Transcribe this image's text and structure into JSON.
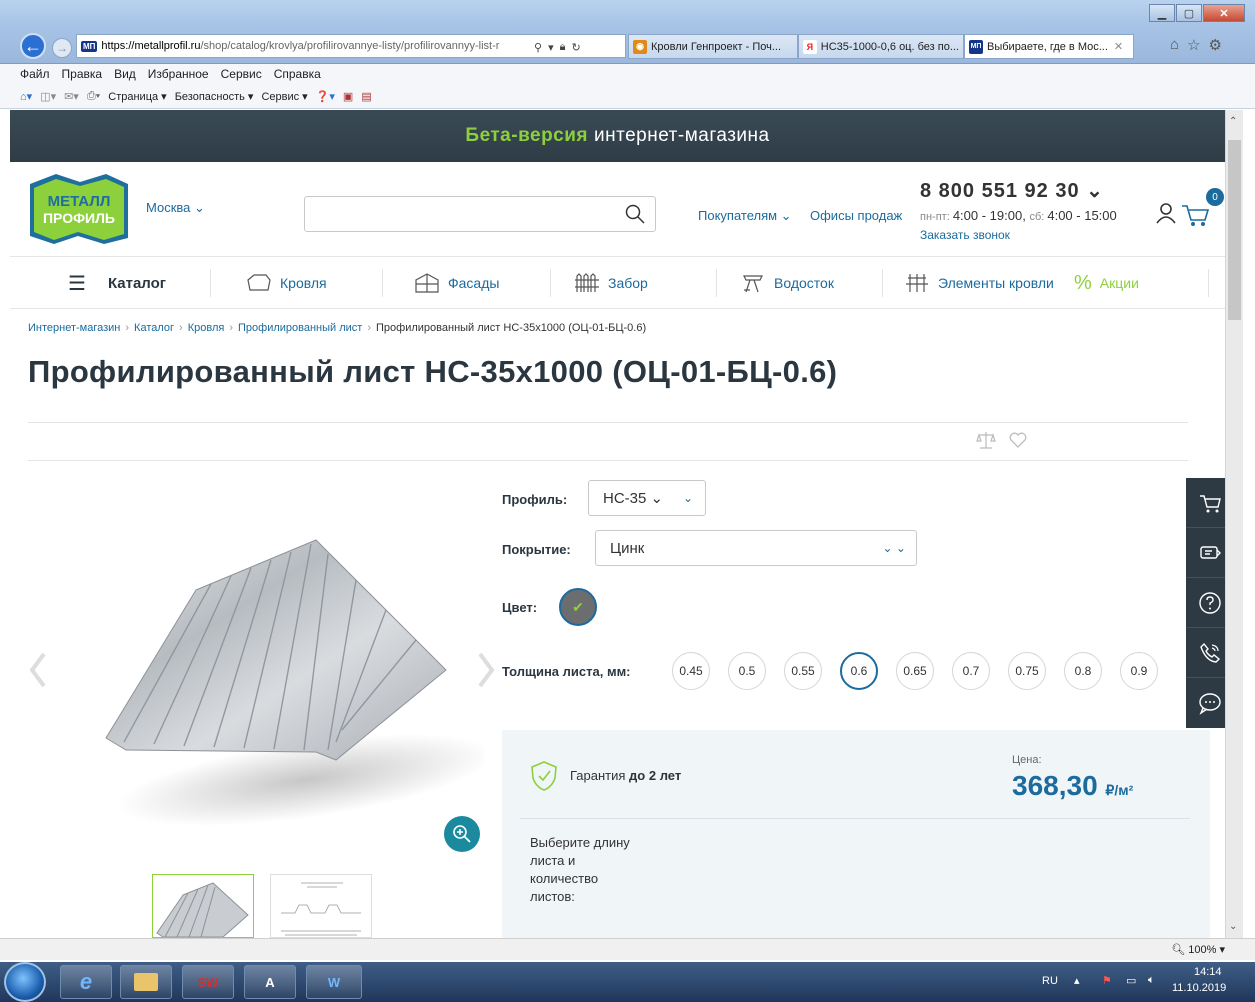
{
  "browser": {
    "url_host": "https://metallprofil.ru",
    "url_rest": "/shop/catalog/krovlya/profilirovannye-listy/profilirovannyy-list-r",
    "ml_badge": "МП",
    "tabs": [
      {
        "label": "Кровли Генпроект - Поч..."
      },
      {
        "label": "НС35-1000-0,6 оц. без по..."
      },
      {
        "label": "Выбираете, где в Мос..."
      }
    ],
    "menu": [
      "Файл",
      "Правка",
      "Вид",
      "Избранное",
      "Сервис",
      "Справка"
    ],
    "cmd": [
      "Страница ▾",
      "Безопасность ▾",
      "Сервис ▾"
    ],
    "zoom": "100%"
  },
  "site": {
    "beta_highlight": "Бета-версия",
    "beta_rest": "интернет-магазина",
    "logo_line1": "МЕТАЛЛ",
    "logo_line2": "ПРОФИЛЬ",
    "city": "Москва ⌄",
    "buyers": "Покупателям ⌄",
    "offices": "Офисы продаж",
    "phone": "8 800 551 92 30 ⌄",
    "hours_label1": "пн-пт: ",
    "hours_val1": "4:00 - 19:00, ",
    "hours_label2": "сб: ",
    "hours_val2": "4:00 - 15:00",
    "callback": "Заказать звонок",
    "cart_count": "0",
    "nav": {
      "catalog": "Каталог",
      "roof": "Кровля",
      "facades": "Фасады",
      "fence": "Забор",
      "drain": "Водосток",
      "roof_elements": "Элементы кровли",
      "promo": "Акции"
    },
    "breadcrumb": [
      "Интернет-магазин",
      "Каталог",
      "Кровля",
      "Профилированный лист",
      "Профилированный лист НС-35х1000 (ОЦ-01-БЦ-0.6)"
    ],
    "title": "Профилированный лист НС-35х1000 (ОЦ-01-БЦ-0.6)",
    "profile_label": "Профиль:",
    "profile_value": "НС-35 ⌄",
    "coating_label": "Покрытие:",
    "coating_value": "Цинк",
    "color_label": "Цвет:",
    "thickness_label": "Толщина листа, мм:",
    "thickness_options": [
      "0.45",
      "0.5",
      "0.55",
      "0.6",
      "0.65",
      "0.7",
      "0.75",
      "0.8",
      "0.9"
    ],
    "thickness_selected": "0.6",
    "guarantee_text": "Гарантия ",
    "guarantee_bold": "до 2 лет",
    "price_label": "Цена:",
    "price_value": "368,30",
    "price_unit": "₽/м²",
    "choose_text": "Выберите длину листа и количество листов:"
  },
  "taskbar": {
    "lang": "RU",
    "time": "14:14",
    "date": "11.10.2019"
  },
  "colors": {
    "accent": "#1b6b9e",
    "green": "#8cd13b",
    "dark": "#2d3a44"
  }
}
